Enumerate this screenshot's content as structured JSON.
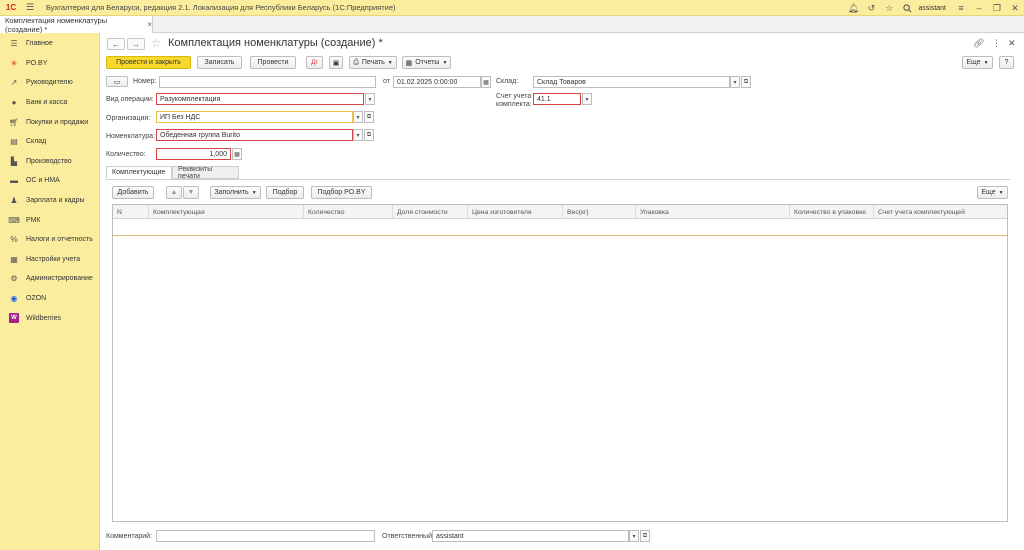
{
  "app": {
    "logo": "1С",
    "title": "Бухгалтерия для Беларуси, редакция 2.1. Локализация для Республики Беларусь   (1С:Предприятие)",
    "user": "assistant"
  },
  "tab": {
    "label": "Комплектация номенклатуры (создание) *"
  },
  "sidebar": {
    "items": [
      {
        "label": "Главное",
        "icon": "menu-icon"
      },
      {
        "label": "PO.BY",
        "icon": "sparkle-icon"
      },
      {
        "label": "Руководителю",
        "icon": "trend-icon"
      },
      {
        "label": "Банк и касса",
        "icon": "coin-icon"
      },
      {
        "label": "Покупки и продажи",
        "icon": "cart-icon"
      },
      {
        "label": "Склад",
        "icon": "warehouse-icon"
      },
      {
        "label": "Производство",
        "icon": "factory-icon"
      },
      {
        "label": "ОС и НМА",
        "icon": "truck-icon"
      },
      {
        "label": "Зарплата и кадры",
        "icon": "person-icon"
      },
      {
        "label": "РМК",
        "icon": "register-icon"
      },
      {
        "label": "Налоги и отчетность",
        "icon": "tax-icon"
      },
      {
        "label": "Настройки учета",
        "icon": "settings-doc-icon"
      },
      {
        "label": "Администрирование",
        "icon": "gear-icon"
      },
      {
        "label": "OZON",
        "icon": "ozon-icon"
      },
      {
        "label": "Wildberries",
        "icon": "wildberries-icon"
      }
    ]
  },
  "doc": {
    "title": "Комплектация номенклатуры (создание) *"
  },
  "toolbar": {
    "post_close": "Провести и закрыть",
    "save": "Записать",
    "post": "Провести",
    "print": "Печать",
    "reports": "Отчеты",
    "more": "Еще",
    "help": "?"
  },
  "form": {
    "number_label": "Номер:",
    "number_value": "",
    "date_label": "от",
    "date_value": "01.02.2025  0:00:00",
    "warehouse_label": "Склад:",
    "warehouse_value": "Склад Товаров",
    "operation_label": "Вид операции:",
    "operation_value": "Разукомплектация",
    "account_label_1": "Счет учета",
    "account_label_2": "комплекта:",
    "account_value": "41.1",
    "org_label": "Организация:",
    "org_value": "ИП Без НДС",
    "item_label": "Номенклатура:",
    "item_value": "Обеденная группа Burito",
    "qty_label": "Количество:",
    "qty_value": "1,000",
    "comment_label": "Комментарий:",
    "comment_value": "",
    "responsible_label": "Ответственный:",
    "responsible_value": "assistant"
  },
  "tabs": [
    {
      "label": "Комплектующие"
    },
    {
      "label": "Реквизиты печати"
    }
  ],
  "table_toolbar": {
    "add": "Добавить",
    "fill": "Заполнить",
    "pick": "Подбор",
    "pick_po": "Подбор PO.BY",
    "more": "Еще"
  },
  "table": {
    "columns": [
      "N",
      "Комплектующая",
      "Количество",
      "Доля стоимости",
      "Цена изготовителя",
      "Вес(кг)",
      "Упаковка",
      "Количество в упаковке",
      "Счет учета комплектующей"
    ],
    "rows": []
  }
}
